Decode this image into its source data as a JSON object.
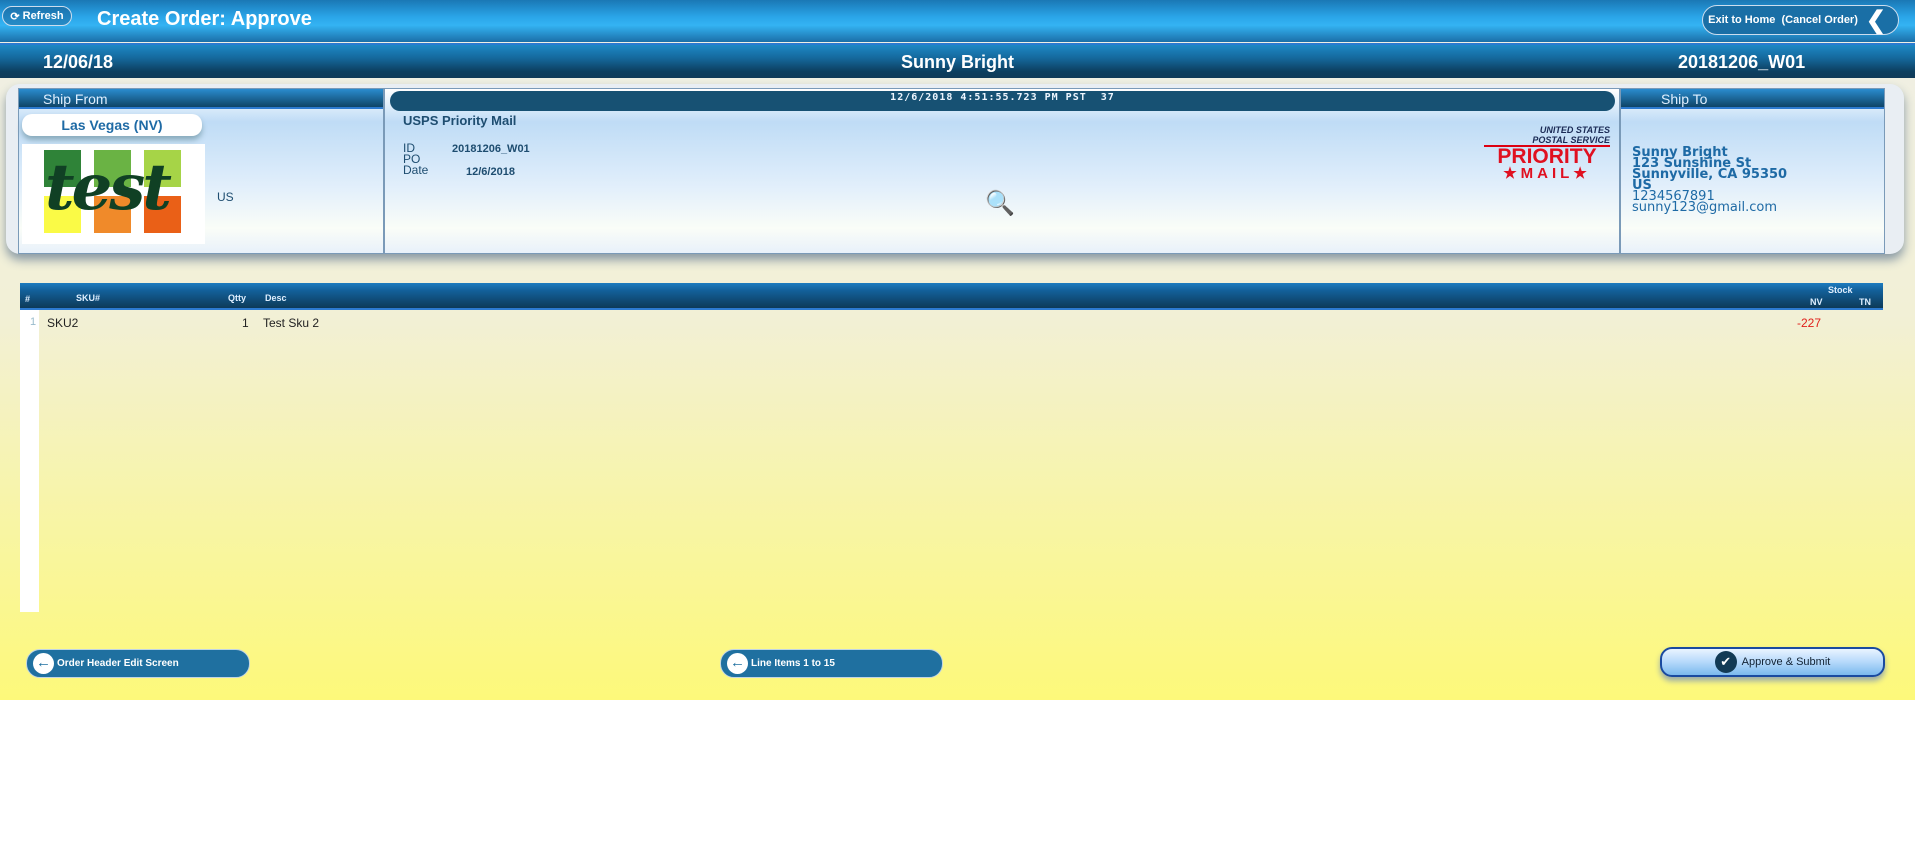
{
  "header": {
    "refresh_label": "Refresh",
    "title": "Create Order: Approve",
    "exit_label": "Exit to Home  (Cancel Order)"
  },
  "subheader": {
    "date": "12/06/18",
    "customer": "Sunny Bright",
    "order_id": "20181206_W01"
  },
  "ship_from": {
    "heading": "Ship From",
    "location": "Las Vegas (NV)",
    "logo_text": "test",
    "country": "US"
  },
  "order": {
    "timestamp": "12/6/2018 4:51:55.723 PM PST  37",
    "carrier": "USPS Priority Mail",
    "id_label": "ID",
    "id_value": "20181206_W01",
    "po_label": "PO",
    "po_value": "",
    "date_label": "Date",
    "date_value": "12/6/2018",
    "carrier_logo_text": "UNITED STATES POSTAL SERVICE PRIORITY MAIL"
  },
  "ship_to": {
    "heading": "Ship To",
    "name": "Sunny Bright",
    "street": "123 Sunshine St",
    "city": "Sunnyville, CA 95350",
    "country": "US",
    "phone": "1234567891",
    "email": "sunny123@gmail.com"
  },
  "table": {
    "columns": {
      "num": "#",
      "sku": "SKU#",
      "qty": "Qtty",
      "desc": "Desc",
      "stock": "Stock",
      "nv": "NV",
      "tn": "TN"
    },
    "rows": [
      {
        "num": "1",
        "sku": "SKU2",
        "qty": "1",
        "desc": "Test Sku 2",
        "nv": "-227",
        "tn": ""
      }
    ]
  },
  "footer": {
    "back_label": "Order Header Edit Screen",
    "lines_label": "Line Items 1 to 15",
    "approve_label": "Approve & Submit"
  },
  "colors": {
    "negative_stock": "#e0201a",
    "accent": "#1f70a0"
  }
}
